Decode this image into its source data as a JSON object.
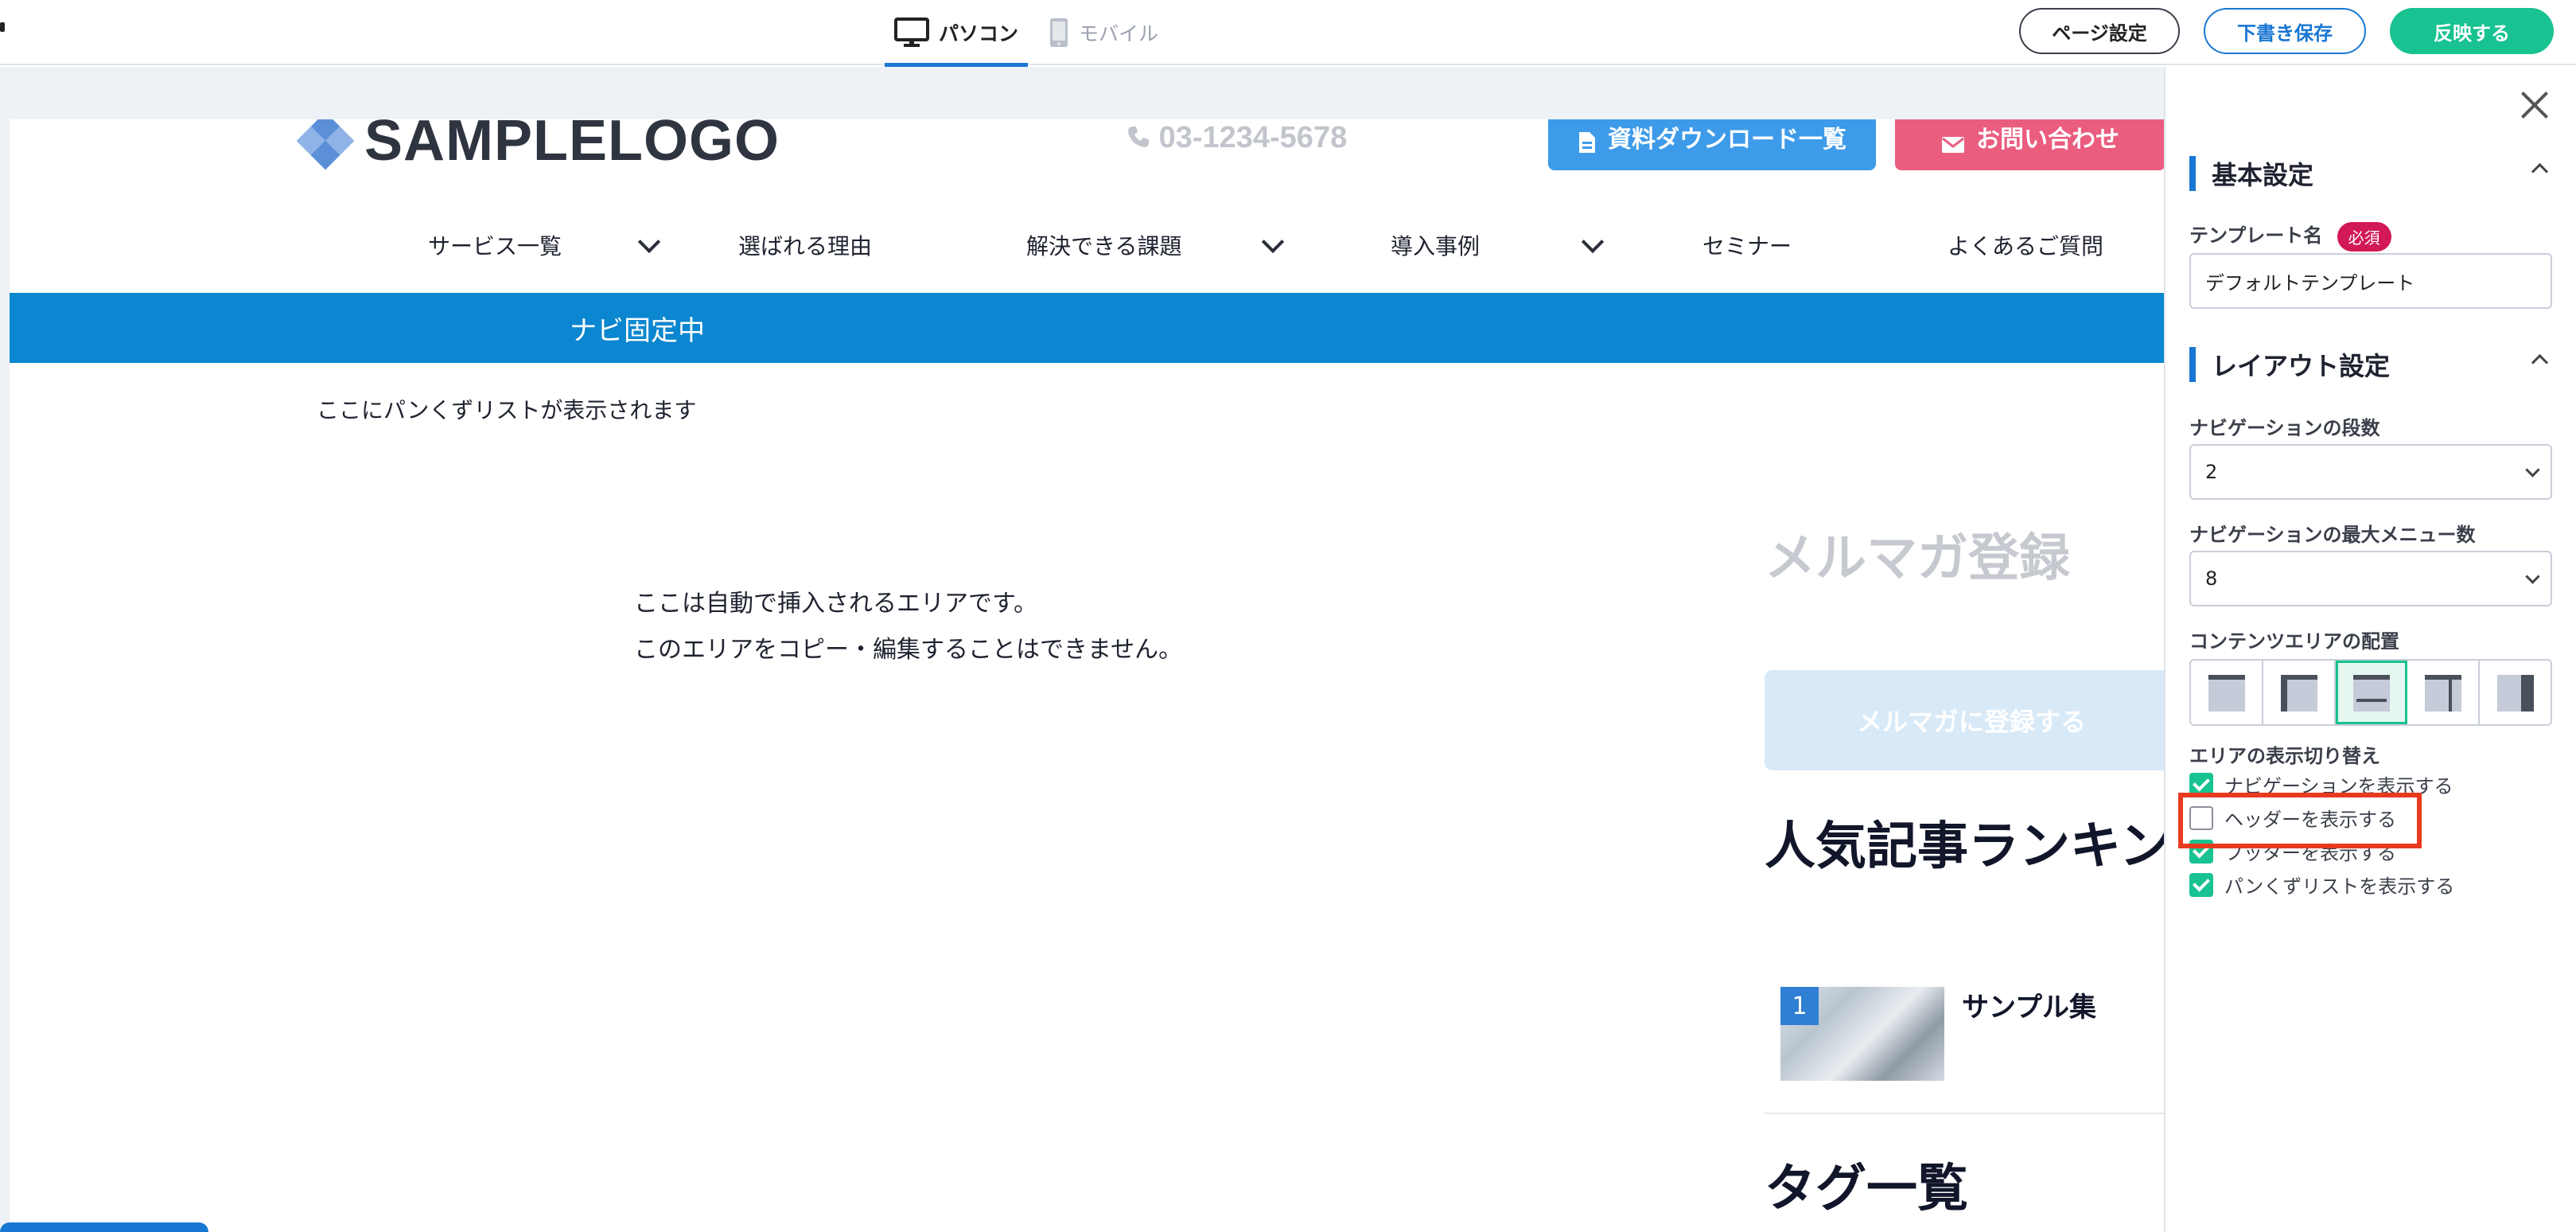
{
  "toolbar": {
    "device_tabs": {
      "pc": "パソコン",
      "mobile": "モバイル"
    },
    "page_settings_label": "ページ設定",
    "draft_save_label": "下書き保存",
    "publish_label": "反映する"
  },
  "preview": {
    "logo_text": "SAMPLELOGO",
    "phone": "03-1234-5678",
    "download_button": "資料ダウンロード一覧",
    "contact_button": "お問い合わせ",
    "nav": [
      "サービス一覧",
      "選ばれる理由",
      "解決できる課題",
      "導入事例",
      "セミナー",
      "よくあるご質問"
    ],
    "fixed_nav_label": "ナビ固定中",
    "breadcrumb_placeholder": "ここにパンくずリストが表示されます",
    "auto_area_line1": "ここは自動で挿入されるエリアです。",
    "auto_area_line2": "このエリアをコピー・編集することはできません。",
    "sidebar": {
      "newsletter_title": "メルマガ登録",
      "newsletter_button": "メルマガに登録する",
      "ranking_title": "人気記事ランキング",
      "ranking_items": [
        {
          "rank": "1",
          "title": "サンプル集"
        }
      ],
      "tags_title": "タグ一覧"
    }
  },
  "panel": {
    "basic_section_title": "基本設定",
    "template_name_label": "テンプレート名",
    "required_badge": "必須",
    "template_name_value": "デフォルトテンプレート",
    "layout_section_title": "レイアウト設定",
    "nav_rows_label": "ナビゲーションの段数",
    "nav_rows_value": "2",
    "nav_max_label": "ナビゲーションの最大メニュー数",
    "nav_max_value": "8",
    "content_layout_label": "コンテンツエリアの配置",
    "content_layout_selected_index": 2,
    "area_toggle_label": "エリアの表示切り替え",
    "toggles": [
      {
        "label": "ナビゲーションを表示する",
        "checked": true
      },
      {
        "label": "ヘッダーを表示する",
        "checked": false
      },
      {
        "label": "フッターを表示する",
        "checked": true
      },
      {
        "label": "パンくずリストを表示する",
        "checked": true
      }
    ]
  },
  "colors": {
    "accent_blue": "#1877d2",
    "publish_green": "#18c291",
    "fixed_nav_blue": "#0b86d0",
    "download_blue": "#3d9be9",
    "contact_pink": "#ea5d7f",
    "required_red": "#d21855",
    "highlight_red": "#e83a1f"
  },
  "icons": {
    "pc_tab": "monitor-icon",
    "mobile_tab": "smartphone-icon",
    "phone": "phone-icon",
    "download": "document-icon",
    "contact": "envelope-icon",
    "close": "close-icon"
  }
}
